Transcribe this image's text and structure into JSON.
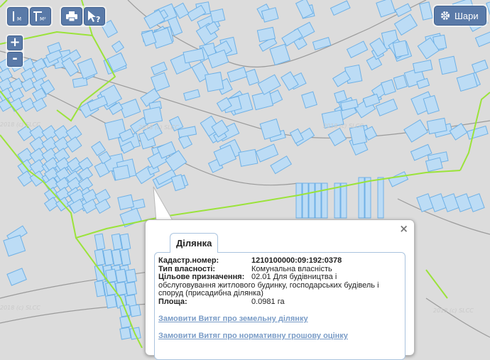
{
  "toolbar": {
    "buttons": [
      {
        "label": "M",
        "icon": "measure-length-icon"
      },
      {
        "label": "M²",
        "icon": "measure-area-icon"
      },
      {
        "label": "",
        "icon": "printer-icon"
      },
      {
        "label": "?",
        "icon": "identify-icon"
      }
    ]
  },
  "zoom": {
    "in": "+",
    "out": "-"
  },
  "layers_button": {
    "label": "Шари",
    "icon": "gear-icon"
  },
  "map": {
    "watermark": "2018 (c) SLCC",
    "parcel_color": "#bcdcf5",
    "parcel_stroke": "#6fb1e6",
    "boundary_color": "#9be33a",
    "road_color": "#9a9a9a"
  },
  "popup": {
    "tab": "Ділянка",
    "close": "×",
    "fields": {
      "cadastral_label": "Кадастр.номер:",
      "cadastral_value": "1210100000:09:192:0378",
      "ownership_label": "Тип власності:",
      "ownership_value": "Комунальна власність",
      "purpose_label": "Цільове призначення:",
      "purpose_value_line1": "02.01 Для будівництва і",
      "purpose_value_line2": "обслуговування житлового будинку, господарських будівель і",
      "purpose_value_line3": "споруд (присадибна ділянка)",
      "area_label": "Площа:",
      "area_value": "0.0981 га"
    },
    "links": [
      "Замовити Витяг про земельну ділянку",
      "Замовити Витяг про нормативну грошову оцінку"
    ]
  }
}
